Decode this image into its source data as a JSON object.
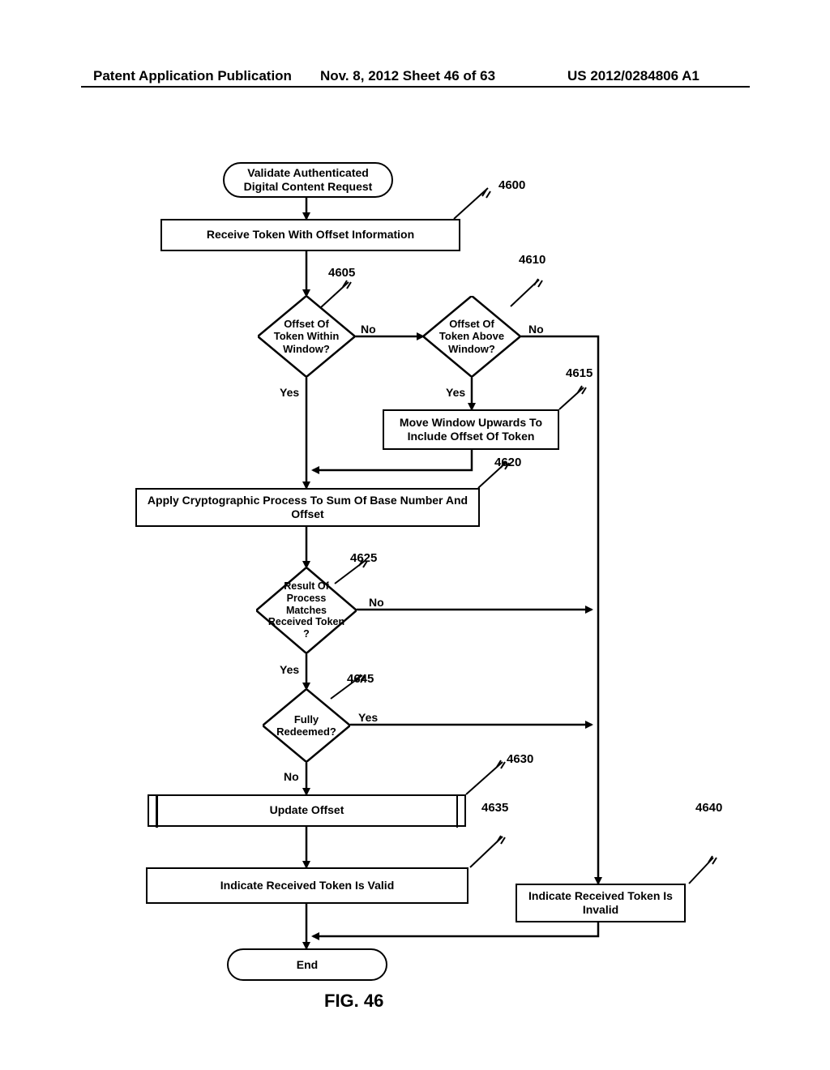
{
  "header": {
    "left": "Patent Application Publication",
    "mid": "Nov. 8, 2012  Sheet 46 of 63",
    "right": "US 2012/0284806 A1"
  },
  "flowchart": {
    "start": "Validate Authenticated Digital Content Request",
    "b4600": "Receive Token With Offset Information",
    "d4605": "Offset Of Token Within Window?",
    "d4610": "Offset Of Token Above Window?",
    "b4615": "Move Window Upwards To Include Offset Of Token",
    "b4620": "Apply Cryptographic Process To Sum Of Base Number And Offset",
    "d4625": "Result Of Process Matches Received Token ?",
    "d4645": "Fully Redeemed?",
    "b4630": "Update Offset",
    "b4635": "Indicate Received Token Is Valid",
    "b4640": "Indicate Received Token Is Invalid",
    "end": "End"
  },
  "labels": {
    "yes": "Yes",
    "no": "No"
  },
  "refs": {
    "r4600": "4600",
    "r4605": "4605",
    "r4610": "4610",
    "r4615": "4615",
    "r4620": "4620",
    "r4625": "4625",
    "r4630": "4630",
    "r4635": "4635",
    "r4640": "4640",
    "r4645": "4645"
  },
  "figure_caption": "FIG. 46"
}
